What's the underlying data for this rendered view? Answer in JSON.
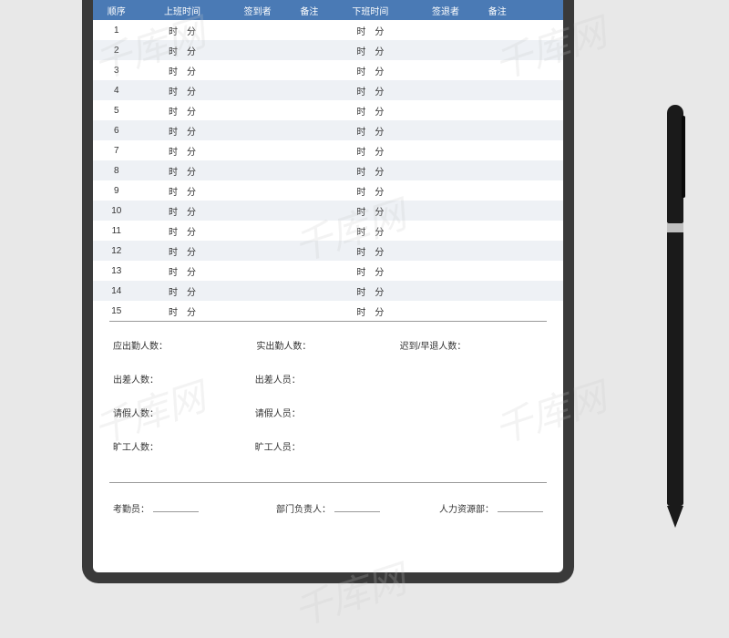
{
  "watermark_text": "千库网",
  "header": {
    "seq": "顺序",
    "ontime": "上班时间",
    "signin": "签到者",
    "note1": "备注",
    "offtime": "下班时间",
    "signout": "签退者",
    "note2": "备注"
  },
  "time_unit": {
    "hour": "时",
    "minute": "分"
  },
  "rows": [
    {
      "seq": "1"
    },
    {
      "seq": "2"
    },
    {
      "seq": "3"
    },
    {
      "seq": "4"
    },
    {
      "seq": "5"
    },
    {
      "seq": "6"
    },
    {
      "seq": "7"
    },
    {
      "seq": "8"
    },
    {
      "seq": "9"
    },
    {
      "seq": "10"
    },
    {
      "seq": "11"
    },
    {
      "seq": "12"
    },
    {
      "seq": "13"
    },
    {
      "seq": "14"
    },
    {
      "seq": "15"
    }
  ],
  "summary": {
    "should_attend": "应出勤人数：",
    "actual_attend": "实出勤人数：",
    "late_early": "迟到/早退人数：",
    "trip_count": "出差人数：",
    "trip_people": "出差人员：",
    "leave_count": "请假人数：",
    "leave_people": "请假人员：",
    "absent_count": "旷工人数：",
    "absent_people": "旷工人员："
  },
  "signatures": {
    "checker": "考勤员：",
    "dept_head": "部门负责人：",
    "hr": "人力资源部："
  }
}
